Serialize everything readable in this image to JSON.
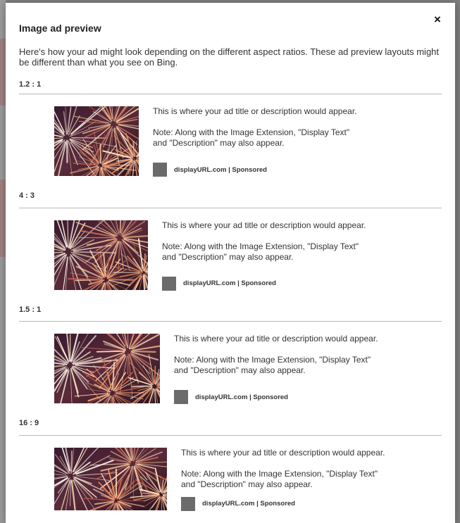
{
  "dialog": {
    "title": "Image ad preview",
    "close_label": "×",
    "intro": "Here's how your ad might look depending on the different aspect ratios. These ad preview layouts might be different than what you see on Bing."
  },
  "previews": [
    {
      "ratio": "1.2 : 1",
      "ad_text": "This is where your ad title or description would appear.",
      "note_line1": "Note: Along with the Image Extension, \"Display Text\"",
      "note_line2": "and \"Description\" may also appear.",
      "url": "displayURL.com | Sponsored"
    },
    {
      "ratio": "4 : 3",
      "ad_text": "This is where your ad title or description would appear.",
      "note_line1": "Note: Along with the Image Extension, \"Display Text\"",
      "note_line2": "and \"Description\" may also appear.",
      "url": "displayURL.com | Sponsored"
    },
    {
      "ratio": "1.5 : 1",
      "ad_text": "This is where your ad title or description would appear.",
      "note_line1": "Note: Along with the Image Extension, \"Display Text\"",
      "note_line2": "and \"Description\" may also appear.",
      "url": "displayURL.com | Sponsored"
    },
    {
      "ratio": "16 : 9",
      "ad_text": "This is where your ad title or description would appear.",
      "note_line1": "Note: Along with the Image Extension, \"Display Text\"",
      "note_line2": "and \"Description\" may also appear.",
      "url": "displayURL.com | Sponsored"
    }
  ],
  "colors": {
    "logo_placeholder": "#6b6b6b",
    "divider": "#b9b9b9",
    "overlay": "#7d7d7d"
  }
}
